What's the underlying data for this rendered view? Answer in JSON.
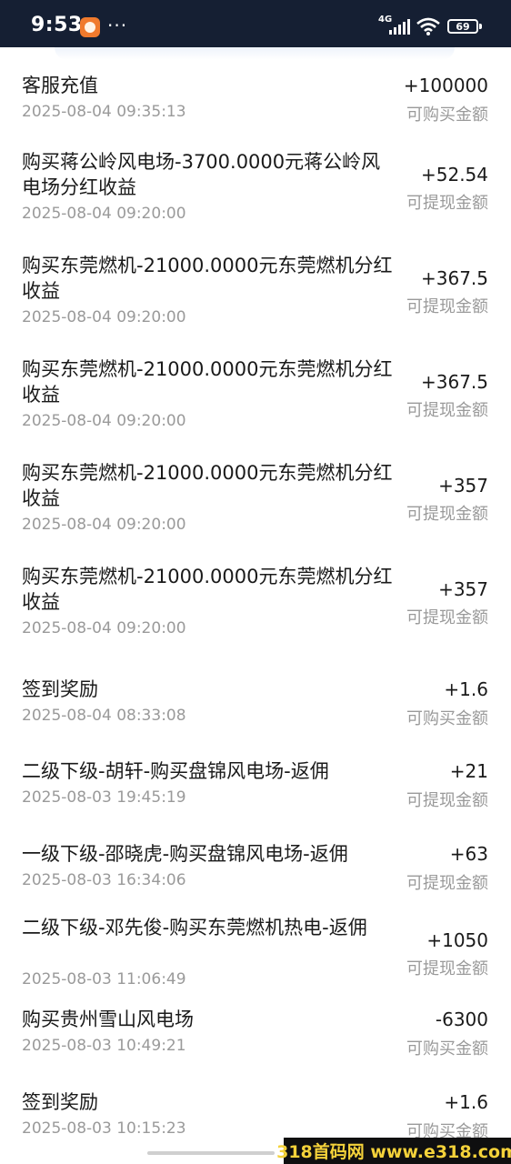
{
  "status_bar": {
    "time": "9:53",
    "network": "4G",
    "battery": "69",
    "more": "···"
  },
  "records": [
    {
      "title": "客服充值",
      "date": "2025-08-04 09:35:13",
      "amount": "+100000",
      "type": "可购买金额"
    },
    {
      "title": "购买蒋公岭风电场-3700.0000元蒋公岭风电场分红收益",
      "date": "2025-08-04 09:20:00",
      "amount": "+52.54",
      "type": "可提现金额"
    },
    {
      "title": "购买东莞燃机-21000.0000元东莞燃机分红收益",
      "date": "2025-08-04 09:20:00",
      "amount": "+367.5",
      "type": "可提现金额"
    },
    {
      "title": "购买东莞燃机-21000.0000元东莞燃机分红收益",
      "date": "2025-08-04 09:20:00",
      "amount": "+367.5",
      "type": "可提现金额"
    },
    {
      "title": "购买东莞燃机-21000.0000元东莞燃机分红收益",
      "date": "2025-08-04 09:20:00",
      "amount": "+357",
      "type": "可提现金额"
    },
    {
      "title": "购买东莞燃机-21000.0000元东莞燃机分红收益",
      "date": "2025-08-04 09:20:00",
      "amount": "+357",
      "type": "可提现金额"
    },
    {
      "title": "签到奖励",
      "date": "2025-08-04 08:33:08",
      "amount": "+1.6",
      "type": "可购买金额"
    },
    {
      "title": "二级下级-胡轩-购买盘锦风电场-返佣",
      "date": "2025-08-03 19:45:19",
      "amount": "+21",
      "type": "可提现金额"
    },
    {
      "title": "一级下级-邵晓虎-购买盘锦风电场-返佣",
      "date": "2025-08-03 16:34:06",
      "amount": "+63",
      "type": "可提现金额"
    },
    {
      "title": "二级下级-邓先俊-购买东莞燃机热电-返佣",
      "date": "2025-08-03 11:06:49",
      "amount": "+1050",
      "type": "可提现金额"
    },
    {
      "title": "购买贵州雪山风电场",
      "date": "2025-08-03 10:49:21",
      "amount": "-6300",
      "type": "可购买金额"
    },
    {
      "title": "签到奖励",
      "date": "2025-08-03 10:15:23",
      "amount": "+1.6",
      "type": "可购买金额"
    }
  ],
  "watermark": "318首码网 www.e318.com"
}
